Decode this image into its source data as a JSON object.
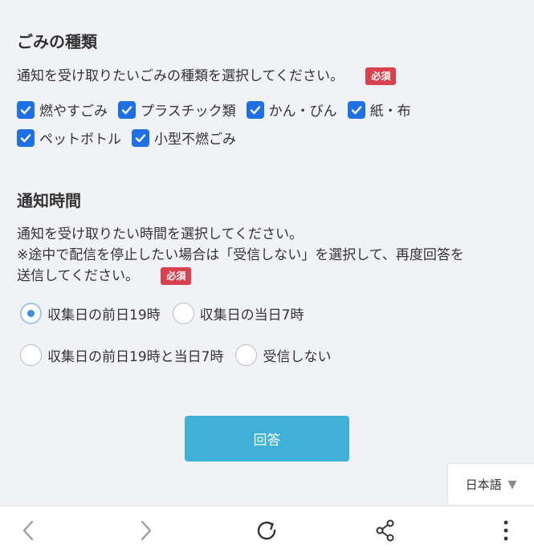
{
  "garbage": {
    "heading": "ごみの種類",
    "description": "通知を受け取りたいごみの種類を選択してください。",
    "required_badge": "必須",
    "options": [
      {
        "label": "燃やすごみ",
        "checked": true
      },
      {
        "label": "プラスチック類",
        "checked": true
      },
      {
        "label": "かん・びん",
        "checked": true
      },
      {
        "label": "紙・布",
        "checked": true
      },
      {
        "label": "ペットボトル",
        "checked": true
      },
      {
        "label": "小型不燃ごみ",
        "checked": true
      }
    ]
  },
  "timing": {
    "heading": "通知時間",
    "description_line1": "通知を受け取りたい時間を選択してください。",
    "description_line2": "※途中で配信を停止したい場合は「受信しない」を選択して、再度回答を",
    "description_line3": "送信してください。",
    "required_badge": "必須",
    "options": [
      {
        "label": "収集日の前日19時",
        "selected": true
      },
      {
        "label": "収集日の当日7時",
        "selected": false
      },
      {
        "label": "収集日の前日19時と当日7時",
        "selected": false
      },
      {
        "label": "受信しない",
        "selected": false
      }
    ]
  },
  "submit_label": "回答",
  "language": {
    "label": "日本語",
    "icon": "caret-down-icon"
  },
  "bottom_nav": {
    "back": "chevron-left-icon",
    "forward": "chevron-right-icon",
    "reload": "reload-icon",
    "share": "share-icon",
    "menu": "more-vertical-icon"
  },
  "colors": {
    "background": "#f1f2f5",
    "checkbox": "#1f6fe5",
    "badge": "#d9414e",
    "submit": "#3fb1d9",
    "radio_dot": "#3d8fe0"
  }
}
